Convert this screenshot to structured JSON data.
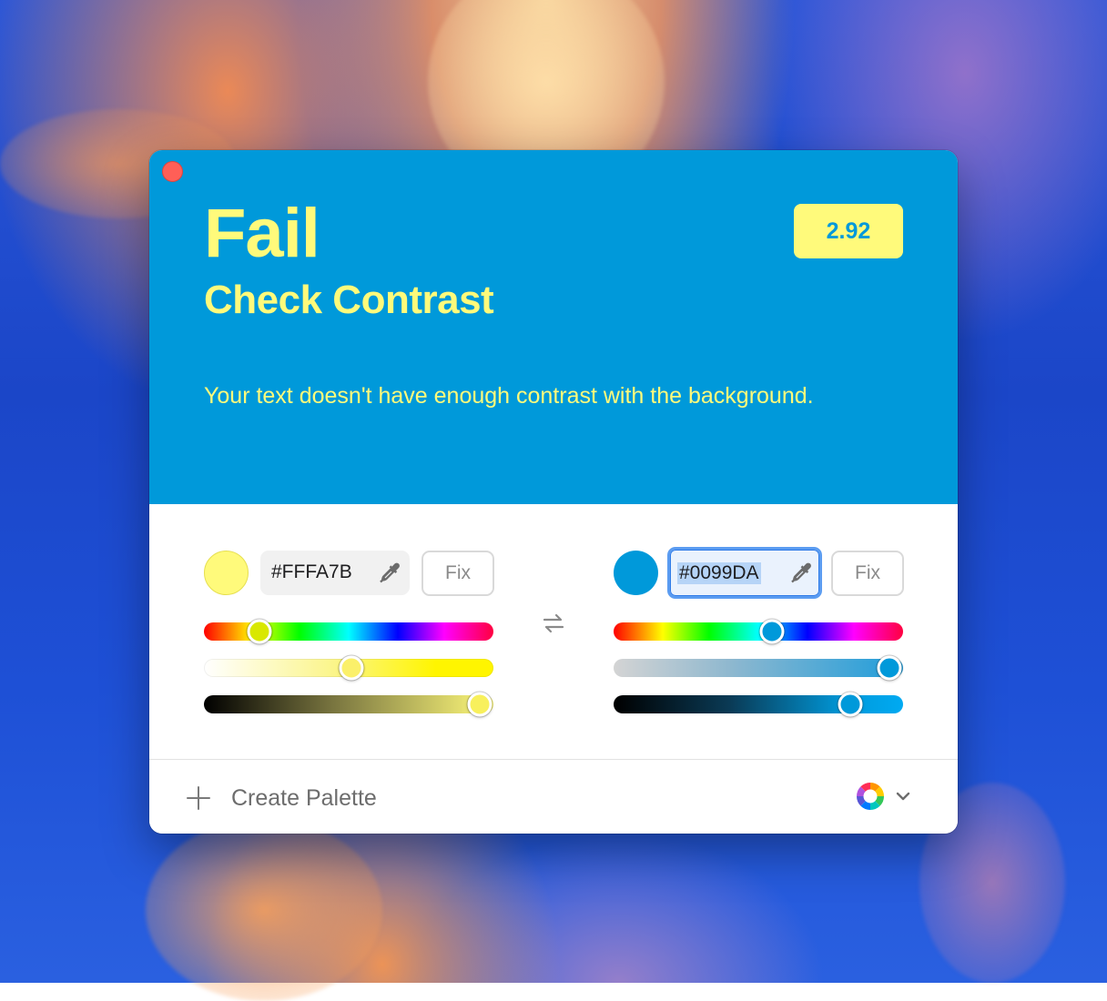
{
  "window": {
    "close_label": "Close"
  },
  "result": {
    "verdict": "Fail",
    "title": "Check Contrast",
    "ratio": "2.92",
    "message": "Your text doesn't have enough contrast with the background."
  },
  "foreground": {
    "hex": "#FFFA7B",
    "color": "#FFFA7B",
    "fix_label": "Fix",
    "hue": 0.18,
    "saturation": 0.51,
    "brightness": 0.97
  },
  "background": {
    "hex": "#0099DA",
    "color": "#0099DA",
    "fix_label": "Fix",
    "hue": 0.55,
    "saturation": 0.97,
    "brightness": 0.83
  },
  "footer": {
    "create_palette_label": "Create Palette"
  },
  "icons": {
    "eyedropper": "eyedropper-icon",
    "swap": "swap-arrows-icon",
    "plus": "plus-icon",
    "color_wheel": "color-wheel-icon",
    "chevron": "chevron-down-icon"
  }
}
